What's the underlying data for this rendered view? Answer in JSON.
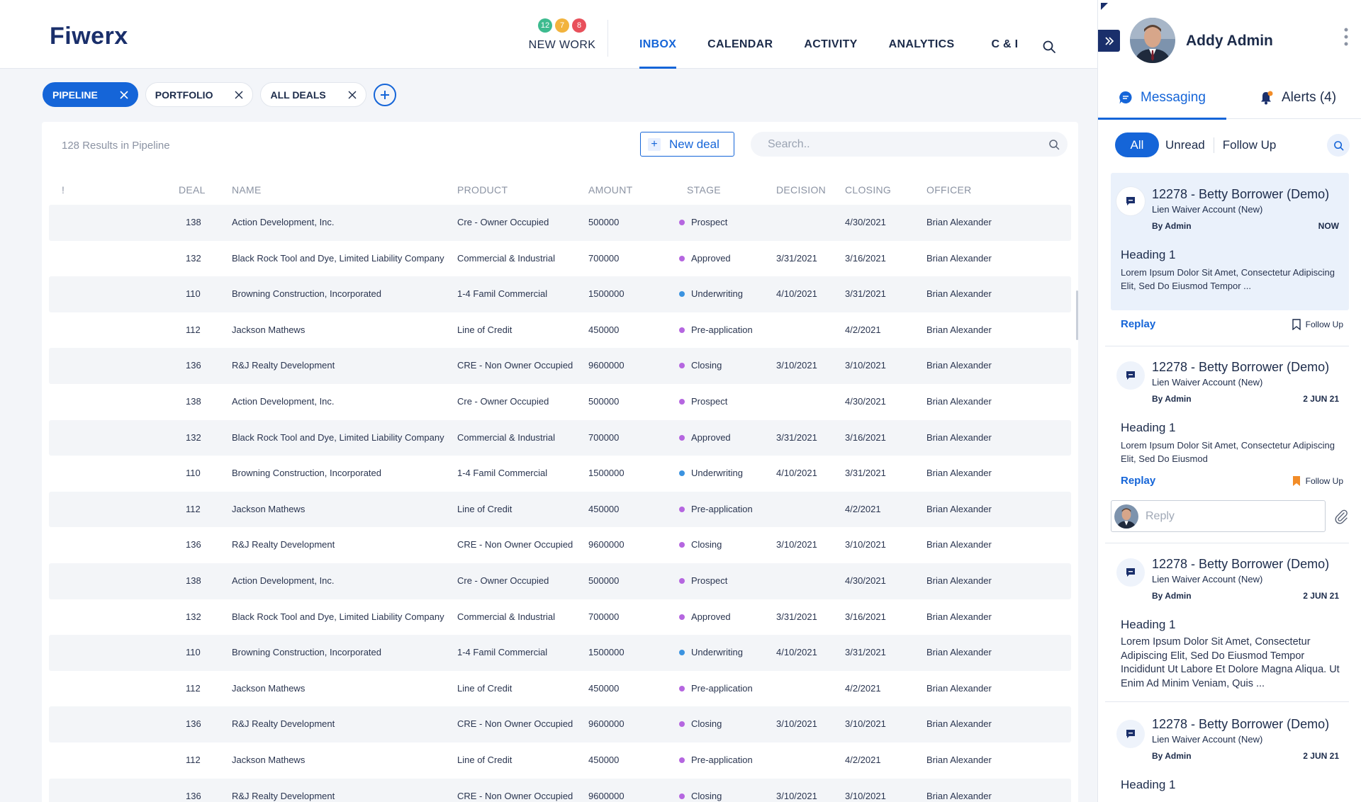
{
  "app": {
    "logo": "Fiwerx"
  },
  "header": {
    "new_work": {
      "label": "NEW WORK",
      "badges": [
        {
          "value": "12",
          "color": "#3dbb8f"
        },
        {
          "value": "7",
          "color": "#f2b33d"
        },
        {
          "value": "8",
          "color": "#e8505b"
        }
      ]
    },
    "nav": [
      {
        "label": "INBOX",
        "active": true
      },
      {
        "label": "CALENDAR",
        "active": false
      },
      {
        "label": "ACTIVITY",
        "active": false
      },
      {
        "label": "ANALYTICS",
        "active": false
      },
      {
        "label": "C & I",
        "active": false
      }
    ]
  },
  "filters": [
    {
      "label": "PIPELINE",
      "active": true
    },
    {
      "label": "PORTFOLIO",
      "active": false
    },
    {
      "label": "ALL DEALS",
      "active": false
    }
  ],
  "table": {
    "results_text": "128 Results in Pipeline",
    "new_deal_label": "New deal",
    "search_placeholder": "Search..",
    "columns": {
      "flag": "!",
      "deal": "DEAL",
      "name": "NAME",
      "product": "PRODUCT",
      "amount": "AMOUNT",
      "stage": "STAGE",
      "decision": "DECISION",
      "closing": "CLOSING",
      "officer": "OFFICER"
    },
    "stage_colors": {
      "Prospect": "#b566e0",
      "Approved": "#b566e0",
      "Underwriting": "#3b93e0",
      "Pre-application": "#b566e0",
      "Closing": "#b566e0"
    },
    "rows": [
      {
        "deal": "138",
        "name": "Action Development, Inc.",
        "product": "Cre - Owner Occupied",
        "amount": "500000",
        "stage": "Prospect",
        "decision": "",
        "closing": "4/30/2021",
        "officer": "Brian Alexander"
      },
      {
        "deal": "132",
        "name": "Black Rock Tool and Dye, Limited Liability Company",
        "product": "Commercial & Industrial",
        "amount": "700000",
        "stage": "Approved",
        "decision": "3/31/2021",
        "closing": "3/16/2021",
        "officer": "Brian Alexander"
      },
      {
        "deal": "110",
        "name": "Browning Construction, Incorporated",
        "product": "1-4 Famil Commercial",
        "amount": "1500000",
        "stage": "Underwriting",
        "decision": "4/10/2021",
        "closing": "3/31/2021",
        "officer": "Brian Alexander"
      },
      {
        "deal": "112",
        "name": "Jackson Mathews",
        "product": "Line of Credit",
        "amount": "450000",
        "stage": "Pre-application",
        "decision": "",
        "closing": "4/2/2021",
        "officer": "Brian Alexander"
      },
      {
        "deal": "136",
        "name": "R&J Realty Development",
        "product": "CRE - Non Owner Occupied",
        "amount": "9600000",
        "stage": "Closing",
        "decision": "3/10/2021",
        "closing": "3/10/2021",
        "officer": "Brian Alexander"
      },
      {
        "deal": "138",
        "name": "Action Development, Inc.",
        "product": "Cre - Owner Occupied",
        "amount": "500000",
        "stage": "Prospect",
        "decision": "",
        "closing": "4/30/2021",
        "officer": "Brian Alexander"
      },
      {
        "deal": "132",
        "name": "Black Rock Tool and Dye, Limited Liability Company",
        "product": "Commercial & Industrial",
        "amount": "700000",
        "stage": "Approved",
        "decision": "3/31/2021",
        "closing": "3/16/2021",
        "officer": "Brian Alexander"
      },
      {
        "deal": "110",
        "name": "Browning Construction, Incorporated",
        "product": "1-4 Famil Commercial",
        "amount": "1500000",
        "stage": "Underwriting",
        "decision": "4/10/2021",
        "closing": "3/31/2021",
        "officer": "Brian Alexander"
      },
      {
        "deal": "112",
        "name": "Jackson Mathews",
        "product": "Line of Credit",
        "amount": "450000",
        "stage": "Pre-application",
        "decision": "",
        "closing": "4/2/2021",
        "officer": "Brian Alexander"
      },
      {
        "deal": "136",
        "name": "R&J Realty Development",
        "product": "CRE - Non Owner Occupied",
        "amount": "9600000",
        "stage": "Closing",
        "decision": "3/10/2021",
        "closing": "3/10/2021",
        "officer": "Brian Alexander"
      },
      {
        "deal": "138",
        "name": "Action Development, Inc.",
        "product": "Cre - Owner Occupied",
        "amount": "500000",
        "stage": "Prospect",
        "decision": "",
        "closing": "4/30/2021",
        "officer": "Brian Alexander"
      },
      {
        "deal": "132",
        "name": "Black Rock Tool and Dye, Limited Liability Company",
        "product": "Commercial & Industrial",
        "amount": "700000",
        "stage": "Approved",
        "decision": "3/31/2021",
        "closing": "3/16/2021",
        "officer": "Brian Alexander"
      },
      {
        "deal": "110",
        "name": "Browning Construction, Incorporated",
        "product": "1-4 Famil Commercial",
        "amount": "1500000",
        "stage": "Underwriting",
        "decision": "4/10/2021",
        "closing": "3/31/2021",
        "officer": "Brian Alexander"
      },
      {
        "deal": "112",
        "name": "Jackson Mathews",
        "product": "Line of Credit",
        "amount": "450000",
        "stage": "Pre-application",
        "decision": "",
        "closing": "4/2/2021",
        "officer": "Brian Alexander"
      },
      {
        "deal": "136",
        "name": "R&J Realty Development",
        "product": "CRE - Non Owner Occupied",
        "amount": "9600000",
        "stage": "Closing",
        "decision": "3/10/2021",
        "closing": "3/10/2021",
        "officer": "Brian Alexander"
      },
      {
        "deal": "112",
        "name": "Jackson Mathews",
        "product": "Line of Credit",
        "amount": "450000",
        "stage": "Pre-application",
        "decision": "",
        "closing": "4/2/2021",
        "officer": "Brian Alexander"
      },
      {
        "deal": "136",
        "name": "R&J Realty Development",
        "product": "CRE - Non Owner Occupied",
        "amount": "9600000",
        "stage": "Closing",
        "decision": "3/10/2021",
        "closing": "3/10/2021",
        "officer": "Brian Alexander"
      }
    ]
  },
  "panel": {
    "user_name": "Addy Admin",
    "tabs": {
      "messaging": "Messaging",
      "alerts": "Alerts (4)"
    },
    "segments": [
      "All",
      "Unread",
      "Follow Up"
    ],
    "reply_placeholder": "Reply",
    "messages": [
      {
        "title": "12278 - Betty Borrower (Demo)",
        "subtitle": "Lien Waiver Account (New)",
        "by": "By Admin",
        "date": "NOW",
        "heading": "Heading 1",
        "body": "Lorem Ipsum Dolor Sit Amet, Consectetur Adipiscing Elit, Sed Do Eiusmod Tempor ...",
        "reply_label": "Replay",
        "follow_label": "Follow Up",
        "followed": false
      },
      {
        "title": "12278 - Betty Borrower (Demo)",
        "subtitle": "Lien Waiver Account (New)",
        "by": "By Admin",
        "date": "2 JUN 21",
        "heading": "Heading 1",
        "body": "Lorem Ipsum Dolor Sit Amet, Consectetur Adipiscing Elit, Sed Do Eiusmod",
        "reply_label": "Replay",
        "follow_label": "Follow Up",
        "followed": true
      },
      {
        "title": "12278 - Betty Borrower (Demo)",
        "subtitle": "Lien Waiver Account (New)",
        "by": "By Admin",
        "date": "2 JUN 21",
        "heading": "Heading 1",
        "body": "Lorem Ipsum Dolor Sit Amet, Consectetur Adipiscing Elit, Sed Do Eiusmod Tempor Incididunt Ut Labore Et Dolore Magna Aliqua. Ut Enim Ad Minim Veniam, Quis ..."
      },
      {
        "title": "12278 - Betty Borrower (Demo)",
        "subtitle": "Lien Waiver Account (New)",
        "by": "By Admin",
        "date": "2 JUN 21",
        "heading": "Heading 1"
      }
    ]
  },
  "colors": {
    "accent": "#1565d8",
    "navy": "#1a2f6b",
    "follow_active": "#f28c28"
  }
}
